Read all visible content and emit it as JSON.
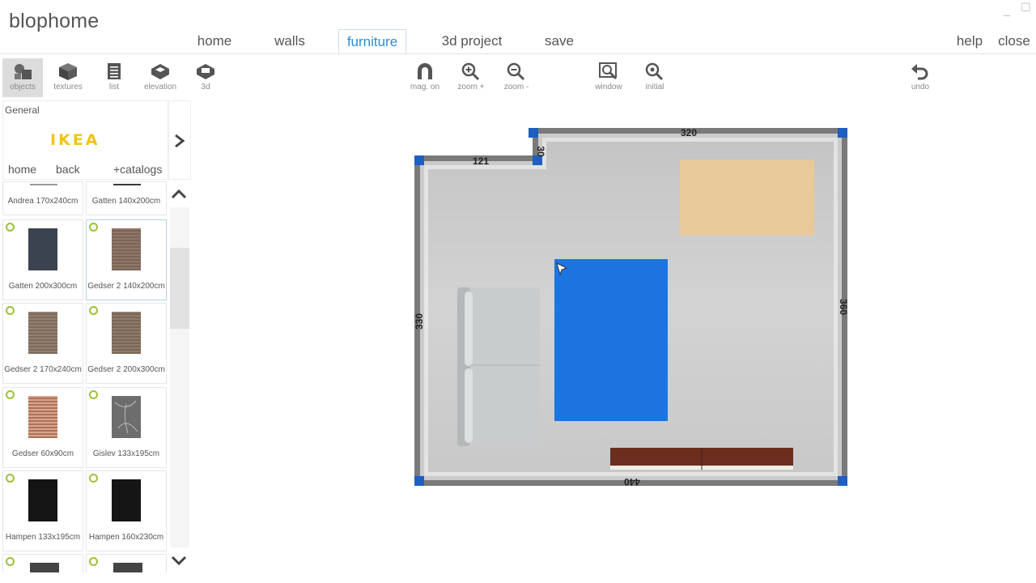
{
  "app": {
    "title": "blophome"
  },
  "window_controls": {
    "minimize": "_",
    "maximize": "☐"
  },
  "nav": {
    "tabs": [
      {
        "label": "home"
      },
      {
        "label": "walls"
      },
      {
        "label": "furniture",
        "active": true
      },
      {
        "label": "3d project"
      },
      {
        "label": "save"
      }
    ],
    "right": [
      {
        "label": "help"
      },
      {
        "label": "close"
      }
    ]
  },
  "toolbar": {
    "left": [
      {
        "label": "objects",
        "icon": "objects-icon",
        "active": true
      },
      {
        "label": "textures",
        "icon": "cube-icon"
      },
      {
        "label": "list",
        "icon": "list-icon"
      },
      {
        "label": "elevation",
        "icon": "elevation-icon"
      },
      {
        "label": "3d",
        "icon": "3d-icon"
      }
    ],
    "center": [
      {
        "label": "mag. on",
        "icon": "magnet-icon"
      },
      {
        "label": "zoom +",
        "icon": "zoom-in-icon"
      },
      {
        "label": "zoom -",
        "icon": "zoom-out-icon"
      },
      {
        "label": "window",
        "icon": "zoom-window-icon"
      },
      {
        "label": "initial",
        "icon": "zoom-initial-icon"
      }
    ],
    "right": [
      {
        "label": "undo",
        "icon": "undo-icon"
      }
    ]
  },
  "catalog": {
    "category": "General",
    "brand": "IKEA",
    "links": {
      "home": "home",
      "back": "back",
      "add": "+catalogs"
    },
    "items": [
      {
        "label": "Andrea 170x240cm",
        "color": "#9a9a9a"
      },
      {
        "label": "Gatten 140x200cm",
        "color": "#3a3a3a"
      },
      {
        "label": "Gatten 200x300cm",
        "color": "#3c4350"
      },
      {
        "label": "Gedser 2 140x200cm",
        "color": "#7a6558",
        "selected": true
      },
      {
        "label": "Gedser 2 170x240cm",
        "color": "#7d6a5c"
      },
      {
        "label": "Gedser 2 200x300cm",
        "color": "#7a6656"
      },
      {
        "label": "Gedser 60x90cm",
        "color": "#b0705a"
      },
      {
        "label": "Gislev 133x195cm",
        "color": "#6d6d6d"
      },
      {
        "label": "Hampen 133x195cm",
        "color": "#141414"
      },
      {
        "label": "Hampen 160x230cm",
        "color": "#151515"
      }
    ]
  },
  "plan": {
    "dimensions": {
      "top_left": "121",
      "notch": "30",
      "top": "320",
      "left": "330",
      "right": "360",
      "bottom": "440"
    },
    "colors": {
      "wall": "#7a7a7a",
      "floor": "#cfcfcf",
      "handle": "#1f5fbf",
      "rug": "#1c74e0",
      "table": "#e8c99a",
      "bench": "#6b2e1f",
      "sofa": "#c9cccc"
    }
  }
}
